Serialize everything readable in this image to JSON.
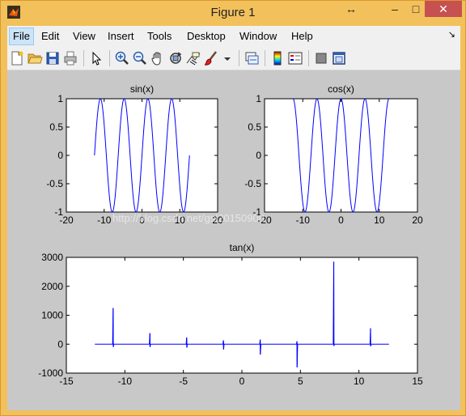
{
  "window": {
    "title": "Figure 1",
    "buttons": {
      "minimize": "–",
      "maximize": "□",
      "close": "✕",
      "restore": "↔"
    }
  },
  "menubar": {
    "items": [
      "File",
      "Edit",
      "View",
      "Insert",
      "Tools",
      "Desktop",
      "Window",
      "Help"
    ],
    "overflow": "↘"
  },
  "toolbar": {
    "tools": [
      "new-figure",
      "open",
      "save",
      "print",
      "edit-plot",
      "zoom-in",
      "zoom-out",
      "pan",
      "rotate-3d",
      "data-cursor",
      "brush",
      "link-plot",
      "colorbar",
      "legend",
      "hide-plot-tools",
      "show-plot-tools"
    ]
  },
  "watermark": "http://blog.csdn.net/gsl20150908",
  "chart_data": [
    {
      "type": "line",
      "title": "sin(x)",
      "xlim": [
        -20,
        20
      ],
      "ylim": [
        -1,
        1
      ],
      "xticks": [
        "-20",
        "-10",
        "0",
        "10",
        "20"
      ],
      "yticks": [
        "-1",
        "-0.5",
        "0",
        "0.5",
        "1"
      ],
      "function": "sin",
      "x_range": [
        -12.566,
        12.566
      ],
      "color": "#0000ff"
    },
    {
      "type": "line",
      "title": "cos(x)",
      "xlim": [
        -20,
        20
      ],
      "ylim": [
        -1,
        1
      ],
      "xticks": [
        "-20",
        "-10",
        "0",
        "10",
        "20"
      ],
      "yticks": [
        "-1",
        "-0.5",
        "0",
        "0.5",
        "1"
      ],
      "function": "cos",
      "x_range": [
        -12.566,
        12.566
      ],
      "color": "#0000ff"
    },
    {
      "type": "line",
      "title": "tan(x)",
      "xlim": [
        -15,
        15
      ],
      "ylim": [
        -1000,
        3000
      ],
      "xticks": [
        "-15",
        "-10",
        "-5",
        "0",
        "5",
        "10",
        "15"
      ],
      "yticks": [
        "-1000",
        "0",
        "1000",
        "2000",
        "3000"
      ],
      "function": "tan",
      "x_range": [
        -12.566,
        12.566
      ],
      "spikes": [
        {
          "x": -10.996,
          "max": 1250,
          "min": -100
        },
        {
          "x": -7.854,
          "max": 380,
          "min": -100
        },
        {
          "x": -4.712,
          "max": 230,
          "min": -120
        },
        {
          "x": -1.571,
          "max": 130,
          "min": -180
        },
        {
          "x": 1.571,
          "max": 160,
          "min": -360
        },
        {
          "x": 4.712,
          "max": 100,
          "min": -800
        },
        {
          "x": 7.854,
          "max": 2850,
          "min": -60
        },
        {
          "x": 10.996,
          "max": 550,
          "min": -70
        }
      ],
      "color": "#0000ff"
    }
  ]
}
